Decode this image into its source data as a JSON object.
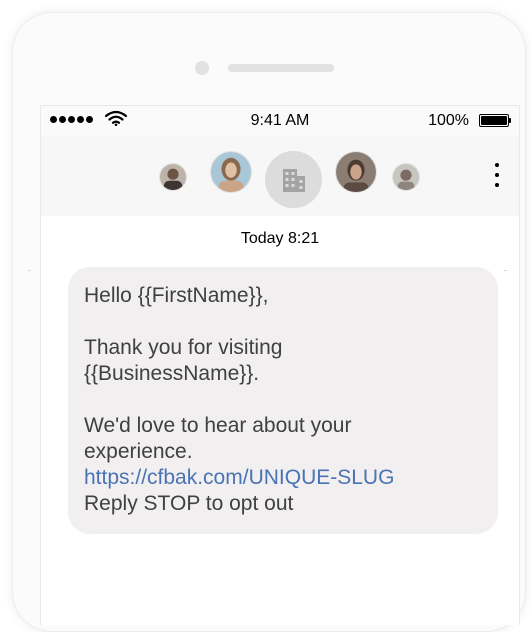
{
  "status_bar": {
    "time": "9:41 AM",
    "battery": "100%",
    "signal_icon": "signal-dots-icon",
    "wifi_icon": "wifi-icon",
    "battery_icon": "battery-icon"
  },
  "header": {
    "group_icon": "building-icon",
    "more_icon": "more-vertical-icon"
  },
  "conversation": {
    "timestamp": "Today 8:21"
  },
  "message": {
    "greeting": "Hello {{FirstName}},",
    "thanks_line1": "Thank you for visiting",
    "thanks_line2": "{{BusinessName}}.",
    "feedback_line1": "We'd love to hear about your",
    "feedback_line2": "experience.",
    "link": "https://cfbak.com/UNIQUE-SLUG",
    "optout": "Reply STOP to opt out"
  },
  "colors": {
    "bubble": "#f1eff0",
    "link": "#4a73b4",
    "text": "#404040"
  }
}
